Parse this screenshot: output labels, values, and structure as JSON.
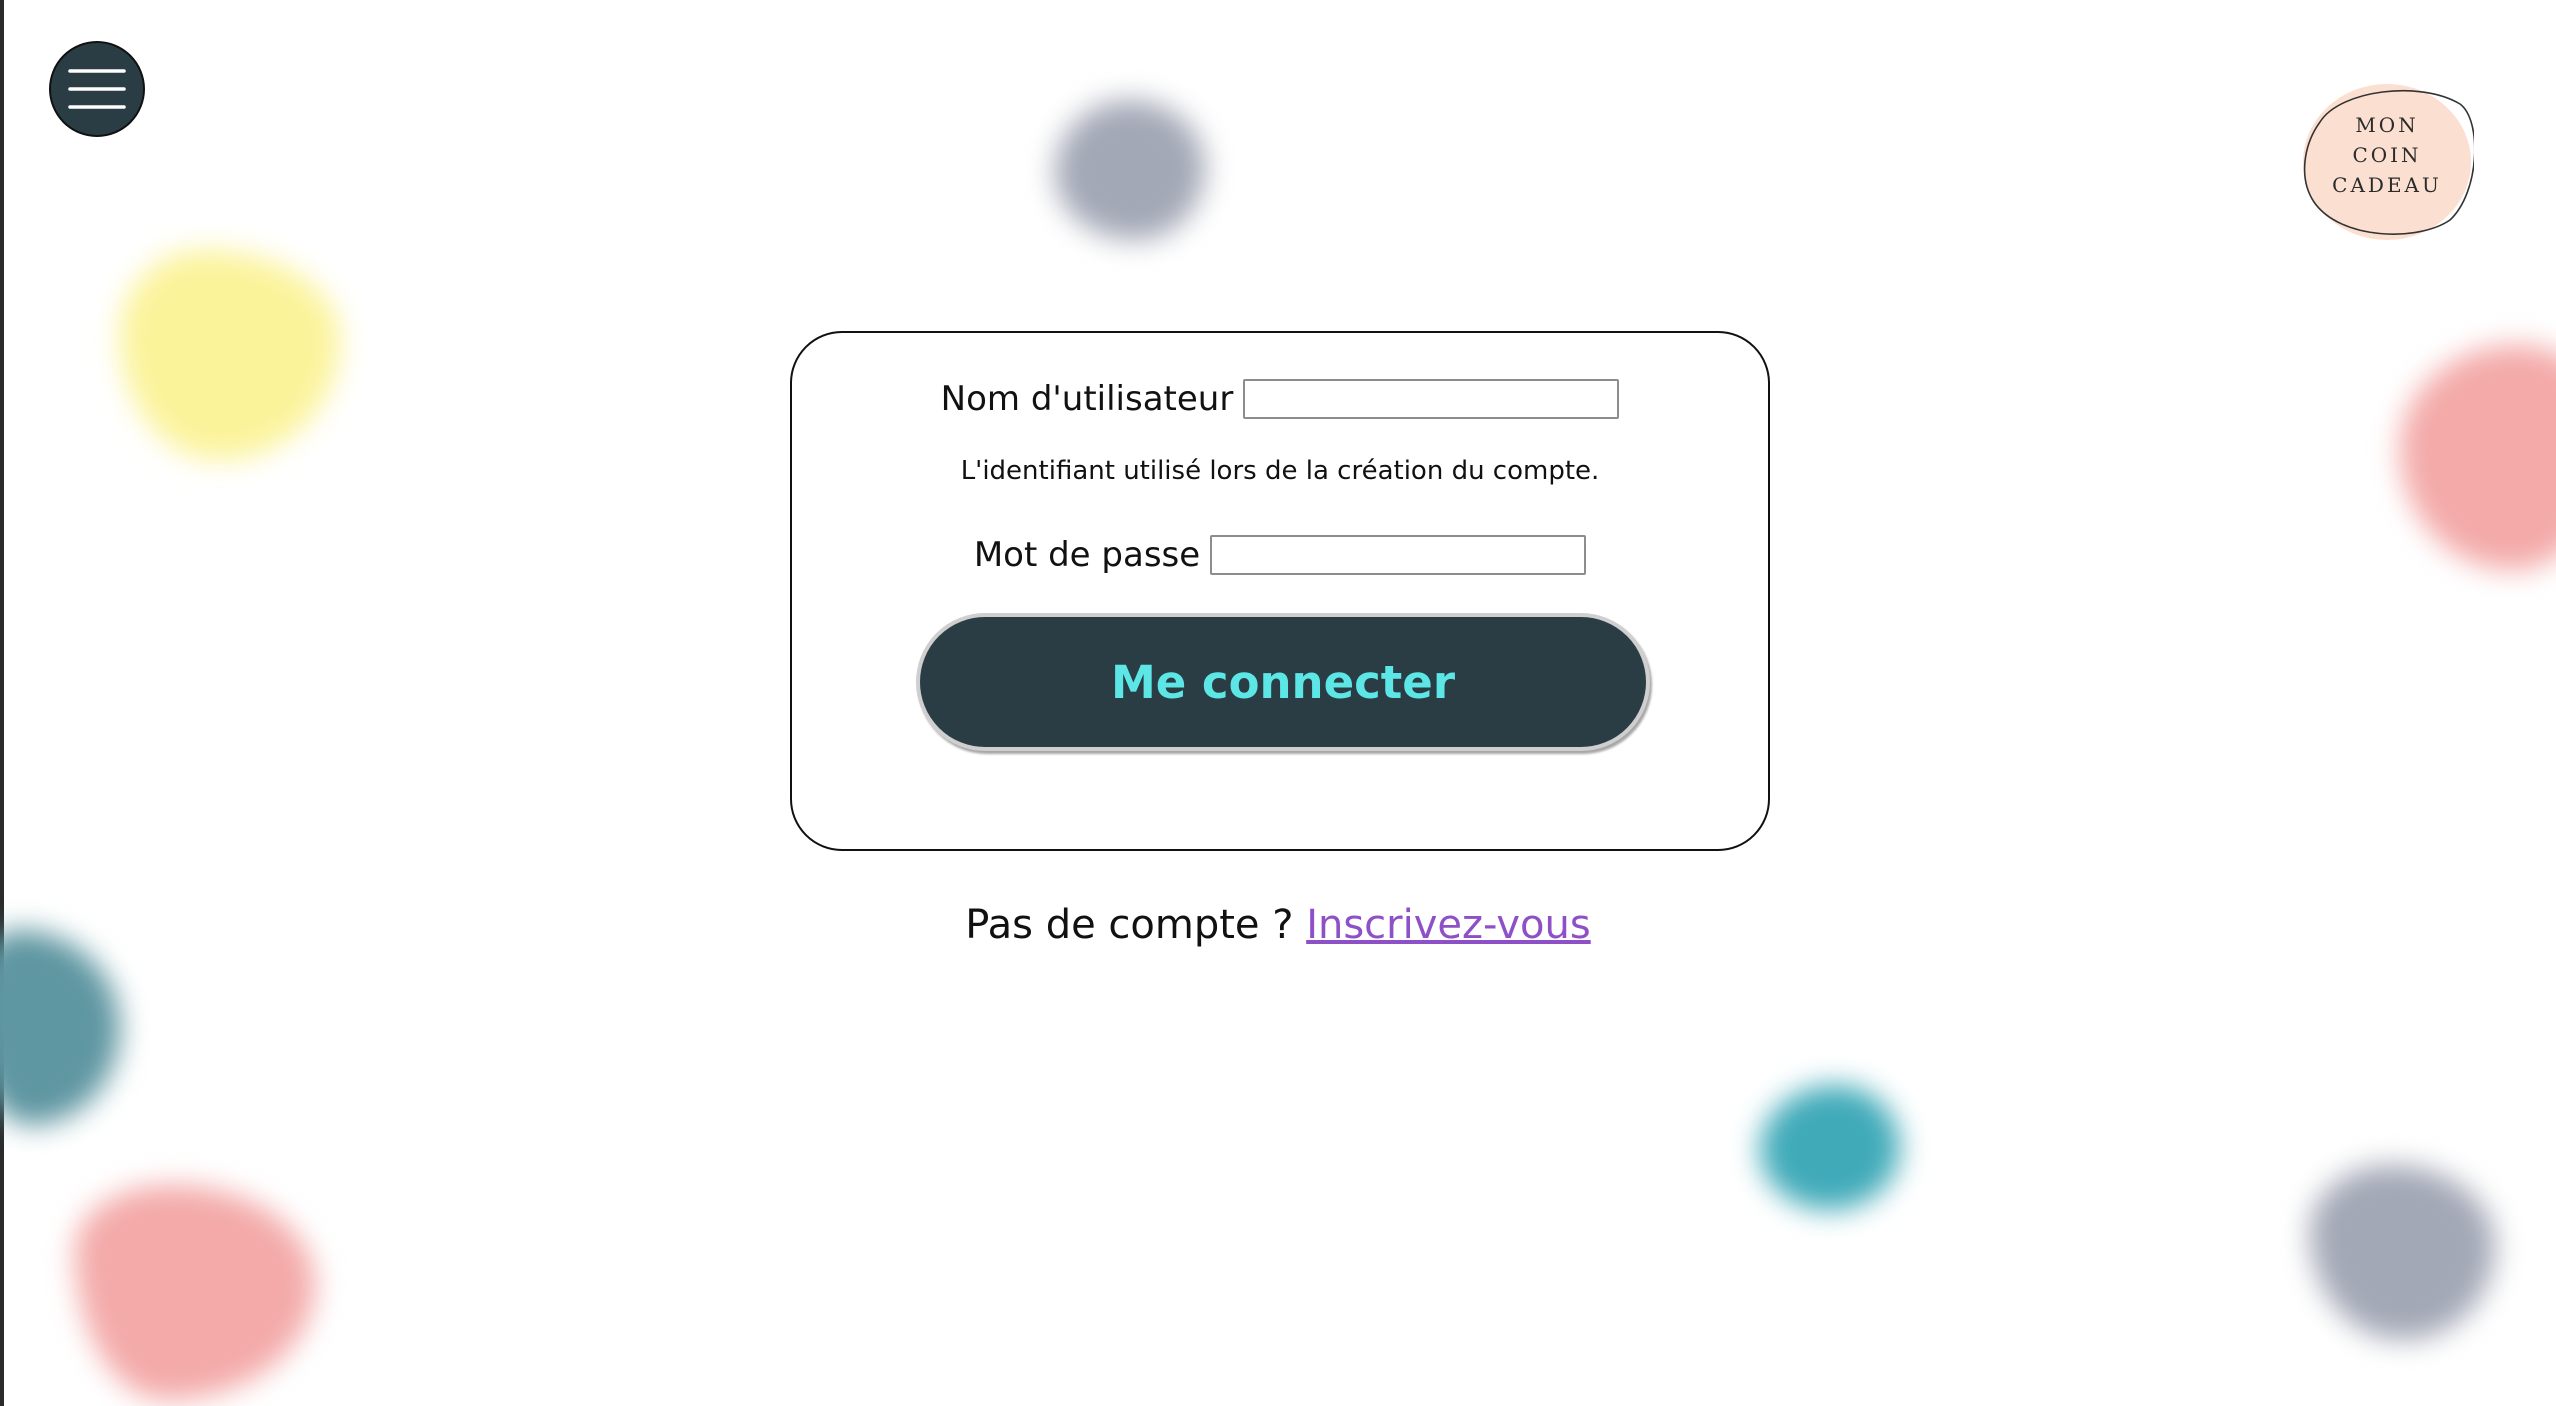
{
  "header": {
    "menu_icon": "hamburger-menu-icon",
    "logo": {
      "lines": [
        "MON",
        "COIN",
        "CADEAU"
      ]
    }
  },
  "login_form": {
    "username_label": "Nom d'utilisateur",
    "username_value": "",
    "username_hint": "L'identifiant utilisé lors de la création du compte.",
    "password_label": "Mot de passe",
    "password_value": "",
    "submit_label": "Me connecter"
  },
  "signup": {
    "prompt": "Pas de compte ? ",
    "link_label": "Inscrivez-vous"
  },
  "colors": {
    "primary_dark": "#2a3d45",
    "button_text": "#5de6e6",
    "link": "#8e50c7",
    "logo_fill": "#fbe0d2"
  },
  "decor": {
    "blob_colors": [
      "#a3a8b6",
      "#fbf39a",
      "#f3aaa9",
      "#5e96a1",
      "#40aab9"
    ]
  }
}
